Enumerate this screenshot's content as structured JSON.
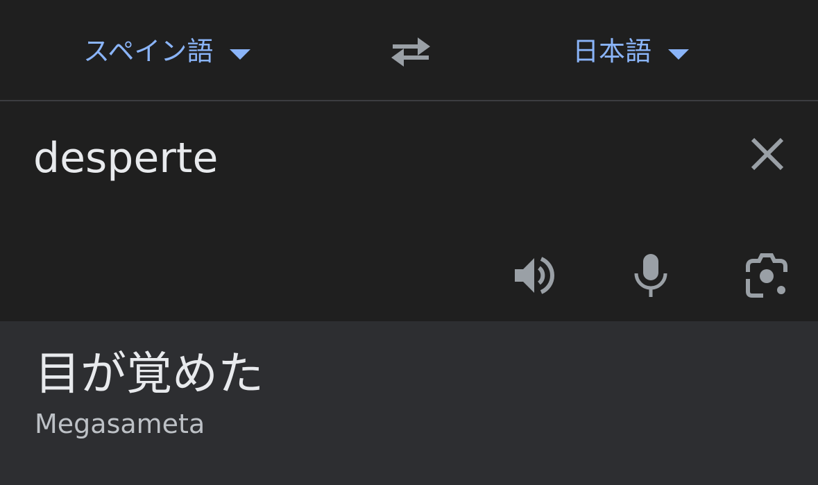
{
  "language_bar": {
    "source_language": "スペイン語",
    "target_language": "日本語",
    "swap_icon": "swap-arrows-icon",
    "caret_icon": "caret-down-icon"
  },
  "input": {
    "text": "desperte",
    "clear_icon": "close-icon",
    "tools": [
      "speaker-icon",
      "microphone-icon",
      "camera-lens-icon"
    ]
  },
  "result": {
    "translation": "目が覚めた",
    "romanization": "Megasameta"
  },
  "colors": {
    "background": "#1f1f1f",
    "result_background": "#2d2e31",
    "accent": "#8ab4f8",
    "text_primary": "#e8eaed",
    "text_secondary": "#bdc1c6",
    "icon_gray": "#9aa0a6",
    "divider": "#3c3d40"
  }
}
